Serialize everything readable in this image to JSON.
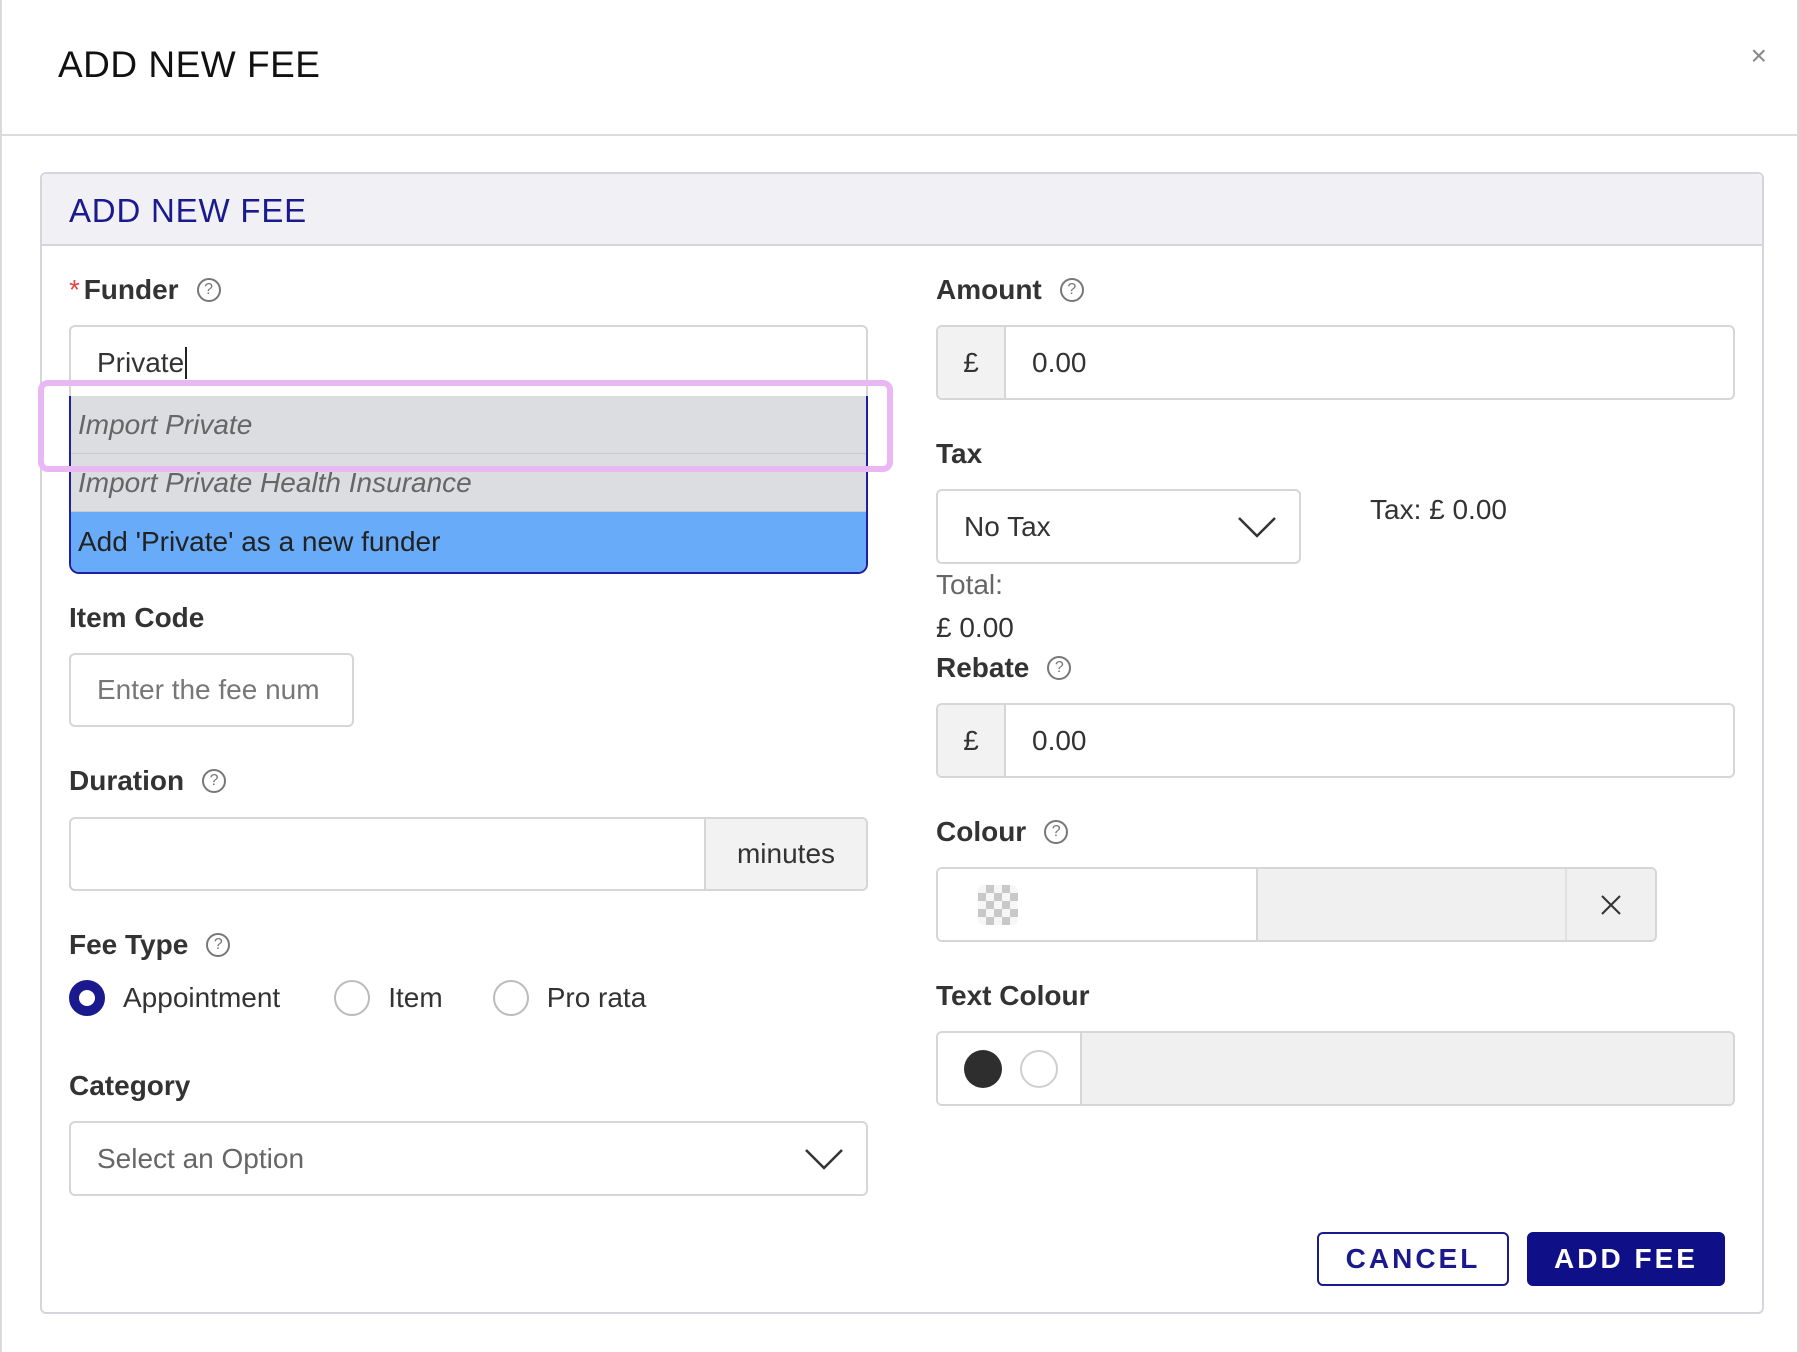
{
  "modal": {
    "title": "ADD NEW FEE",
    "close_symbol": "×"
  },
  "panel": {
    "title": "ADD NEW FEE"
  },
  "funder": {
    "required_mark": "*",
    "label": "Funder",
    "value": "Private",
    "options": [
      {
        "label": "Import Private"
      },
      {
        "label": "Import Private Health Insurance"
      },
      {
        "label": "Add 'Private' as a new funder"
      }
    ]
  },
  "item_code": {
    "label": "Item Code",
    "placeholder": "Enter the fee num"
  },
  "duration": {
    "label": "Duration",
    "value": "",
    "suffix": "minutes"
  },
  "fee_type": {
    "label": "Fee Type",
    "options": [
      "Appointment",
      "Item",
      "Pro rata"
    ],
    "selected": "Appointment"
  },
  "category": {
    "label": "Category",
    "placeholder": "Select an Option"
  },
  "amount": {
    "label": "Amount",
    "currency": "£",
    "value": "0.00"
  },
  "tax": {
    "label": "Tax",
    "selected": "No Tax",
    "summary": "Tax: £ 0.00"
  },
  "total": {
    "label": "Total:",
    "value": "£ 0.00"
  },
  "rebate": {
    "label": "Rebate",
    "currency": "£",
    "value": "0.00"
  },
  "colour": {
    "label": "Colour"
  },
  "text_colour": {
    "label": "Text Colour"
  },
  "actions": {
    "cancel": "CANCEL",
    "submit": "ADD FEE"
  },
  "help_symbol": "?",
  "colors": {
    "accent": "#1a1a8e",
    "dropdown_active": "#68acf9",
    "highlight": "#e9b8f4"
  }
}
